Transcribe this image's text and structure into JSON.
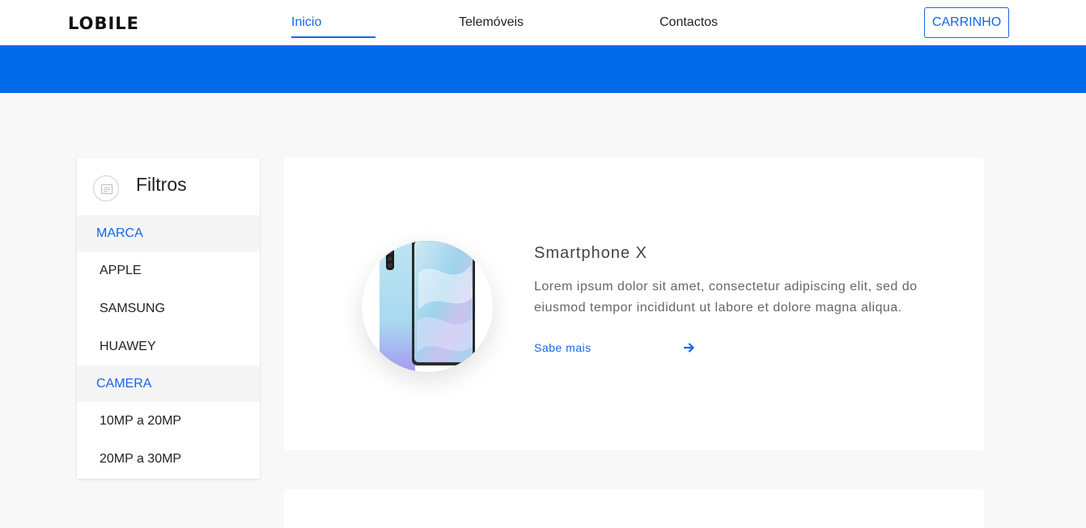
{
  "brand": {
    "logo": "LOBILE"
  },
  "nav": {
    "items": [
      {
        "label": "Inicio",
        "active": true
      },
      {
        "label": "Telemóveis",
        "active": false
      },
      {
        "label": "Contactos",
        "active": false
      }
    ],
    "cart_label": "CARRINHO"
  },
  "colors": {
    "accent": "#1565e8",
    "banner": "#006ae8",
    "background": "#f8f8f8"
  },
  "filters": {
    "title": "Filtros",
    "icon": "filter-icon",
    "groups": [
      {
        "label": "MARCA",
        "items": [
          "APPLE",
          "SAMSUNG",
          "HUAWEY"
        ]
      },
      {
        "label": "CAMERA",
        "items": [
          "10MP a 20MP",
          "20MP a 30MP"
        ]
      }
    ]
  },
  "product": {
    "name": "Smartphone X",
    "description": "Lorem ipsum dolor sit amet, consectetur adipiscing elit, sed do eiusmod tempor incididunt ut labore et dolore magna aliqua.",
    "link_label": "Sabe mais",
    "link_icon": "arrow-right-icon",
    "image": "smartphone-image"
  }
}
